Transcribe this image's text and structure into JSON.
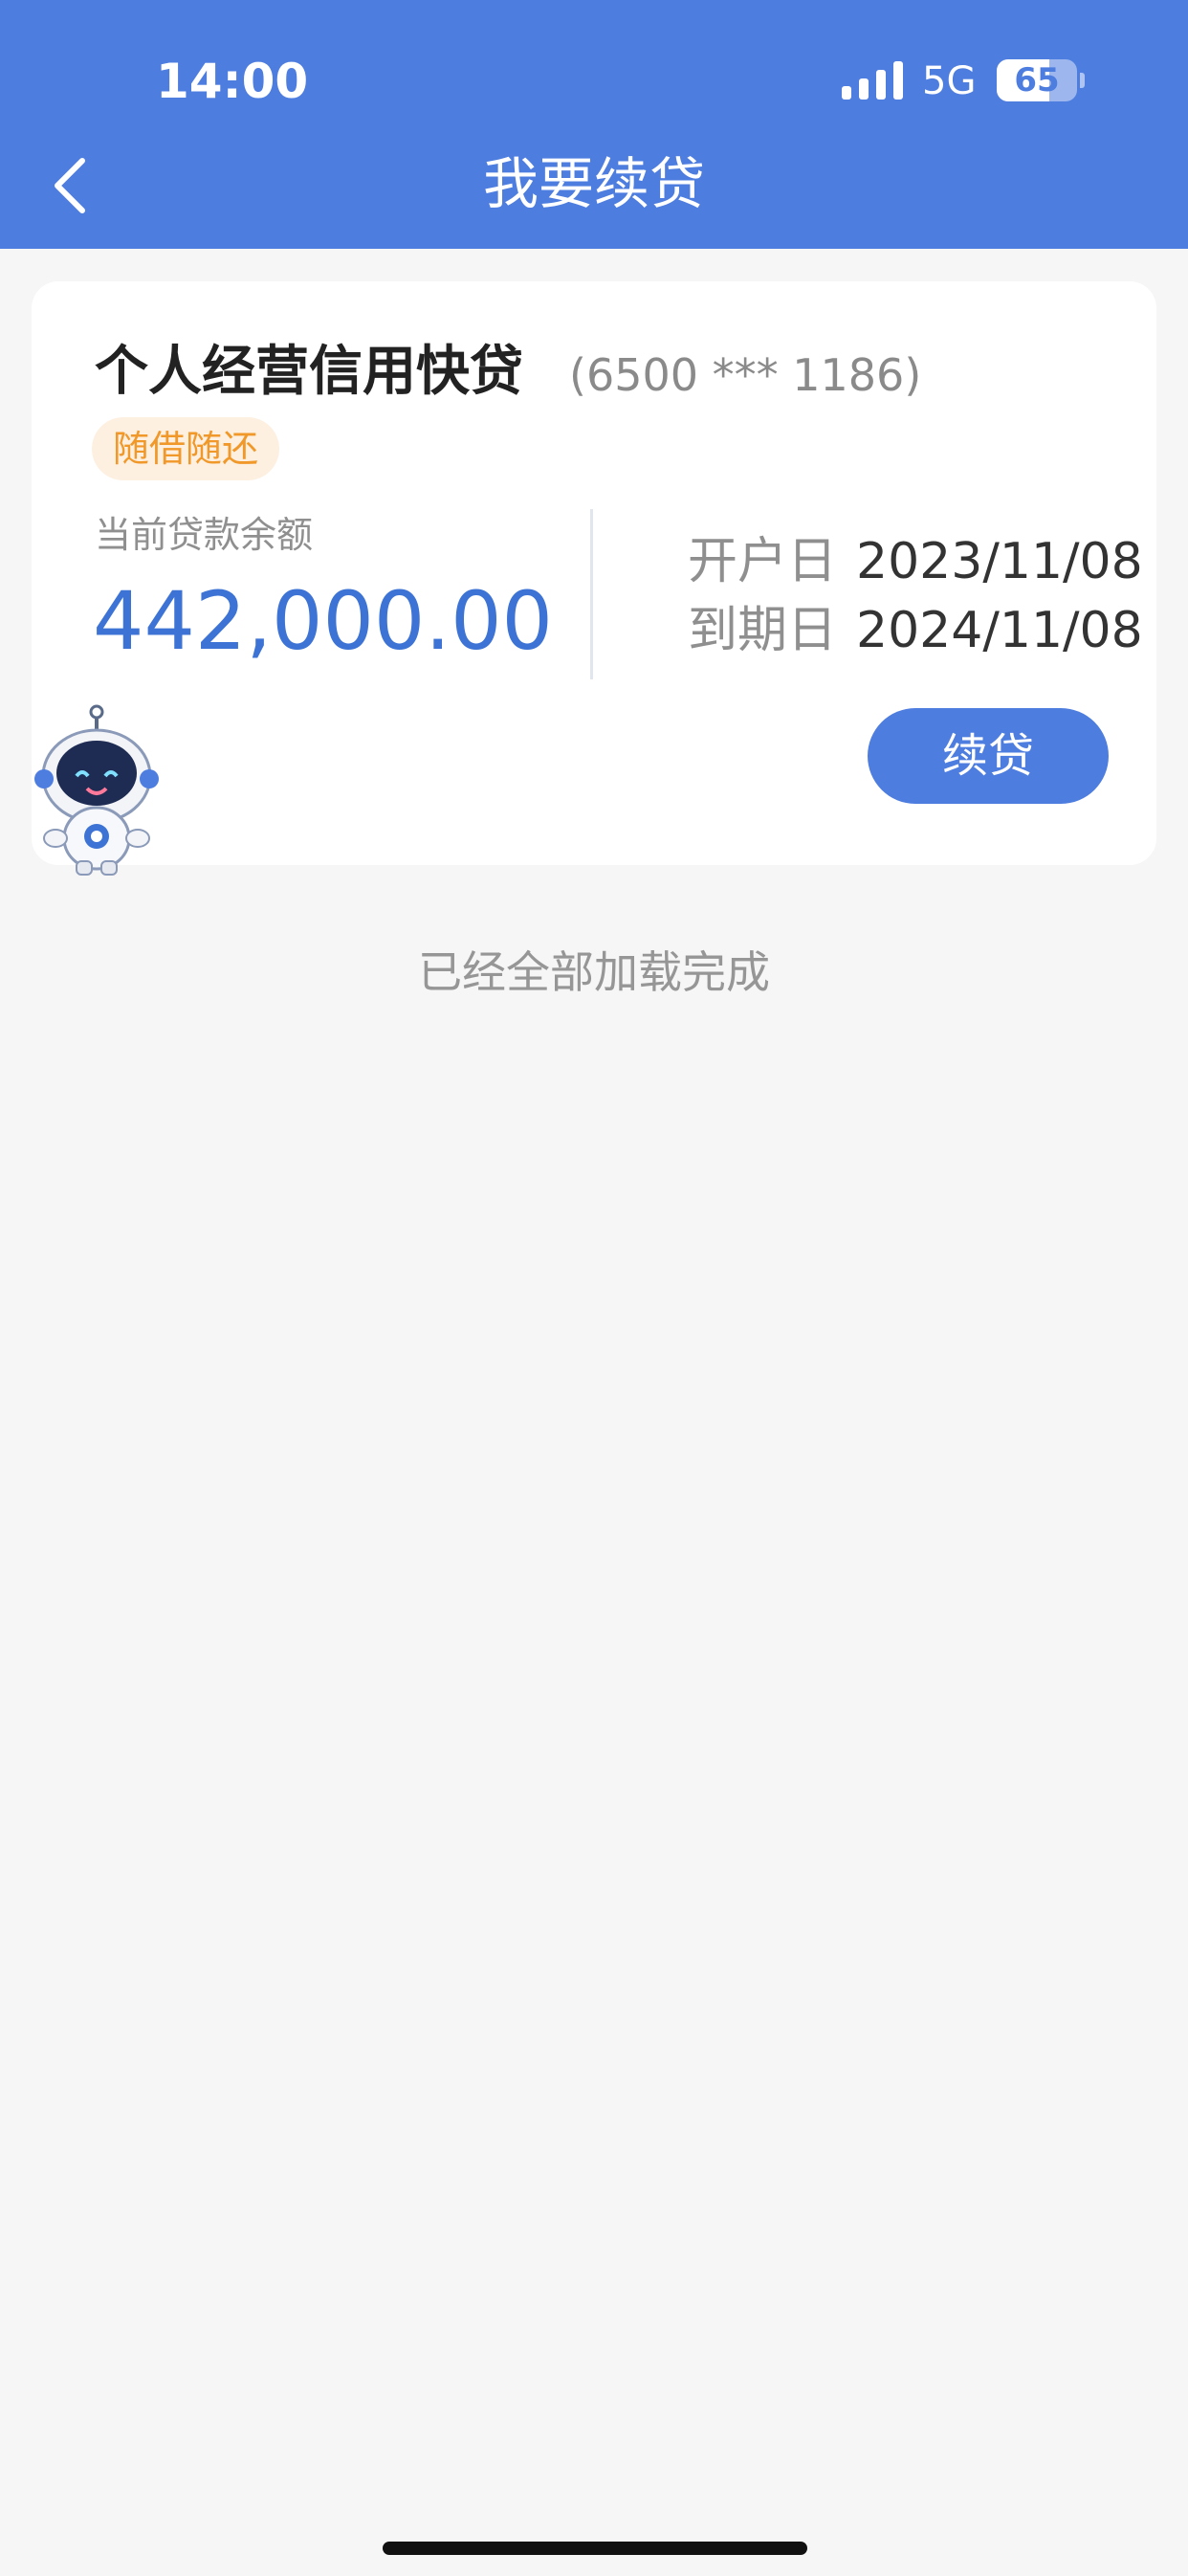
{
  "status_bar": {
    "time": "14:00",
    "network": "5G",
    "battery_level": "65",
    "battery_fraction": 0.65
  },
  "header": {
    "title": "我要续贷",
    "back_icon": "chevron-left-icon"
  },
  "loan_card": {
    "product_name": "个人经营信用快贷",
    "account_number": "(6500 *** 1186)",
    "repayment_tag": "随借随还",
    "balance_label": "当前贷款余额",
    "balance_value": "442,000.00",
    "open_date_label": "开户日",
    "open_date": "2023/11/08",
    "due_date_label": "到期日",
    "due_date": "2024/11/08",
    "renew_button_label": "续贷",
    "mascot_icon": "robot-mascot-icon"
  },
  "footer": {
    "load_status": "已经全部加载完成"
  },
  "colors": {
    "header_bg": "#4e7de0",
    "accent": "#3c73d4",
    "tag_text": "#f1982a",
    "tag_bg": "#fdf0e1",
    "page_bg": "#f6f6f6"
  }
}
